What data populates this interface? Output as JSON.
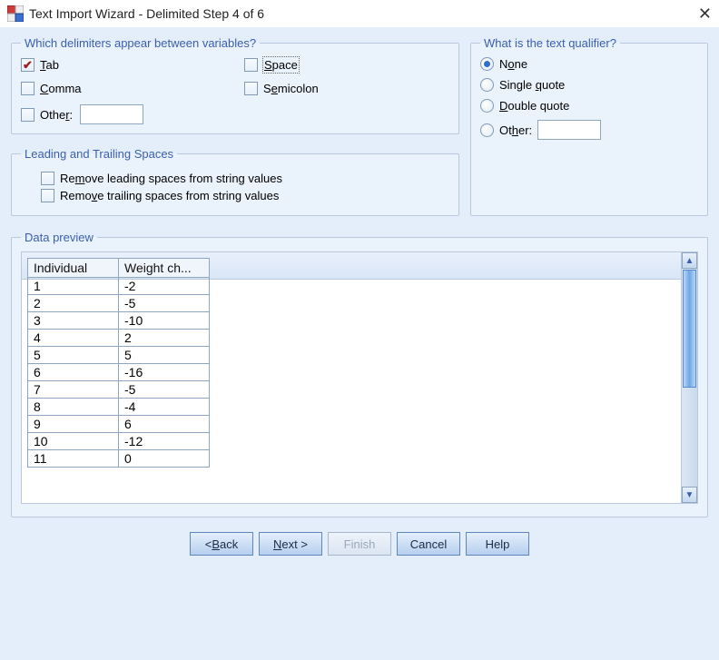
{
  "window": {
    "title": "Text Import Wizard - Delimited Step 4 of 6"
  },
  "delimiters": {
    "legend": "Which delimiters appear between variables?",
    "tab_label": "Tab",
    "space_label": "Space",
    "comma_label": "Comma",
    "semicolon_label": "Semicolon",
    "other_label": "Other:",
    "tab_checked": true,
    "space_checked": false,
    "comma_checked": false,
    "semicolon_checked": false,
    "other_checked": false,
    "other_value": ""
  },
  "leadtrail": {
    "legend": "Leading and Trailing Spaces",
    "remove_leading_label": "Remove leading spaces from string values",
    "remove_trailing_label": "Remove trailing spaces from string values",
    "remove_leading_checked": false,
    "remove_trailing_checked": false
  },
  "qualifier": {
    "legend": "What is the text qualifier?",
    "none_label": "None",
    "single_label": "Single quote",
    "double_label": "Double quote",
    "other_label": "Other:",
    "selected": "none",
    "other_value": ""
  },
  "preview": {
    "legend": "Data preview",
    "headers": [
      "Individual",
      "Weight ch..."
    ],
    "rows": [
      [
        "1",
        "-2"
      ],
      [
        "2",
        "-5"
      ],
      [
        "3",
        "-10"
      ],
      [
        "4",
        "2"
      ],
      [
        "5",
        "5"
      ],
      [
        "6",
        "-16"
      ],
      [
        "7",
        "-5"
      ],
      [
        "8",
        "-4"
      ],
      [
        "9",
        "6"
      ],
      [
        "10",
        "-12"
      ],
      [
        "11",
        "0"
      ]
    ]
  },
  "buttons": {
    "back": "< Back",
    "next": "Next >",
    "finish": "Finish",
    "cancel": "Cancel",
    "help": "Help"
  }
}
